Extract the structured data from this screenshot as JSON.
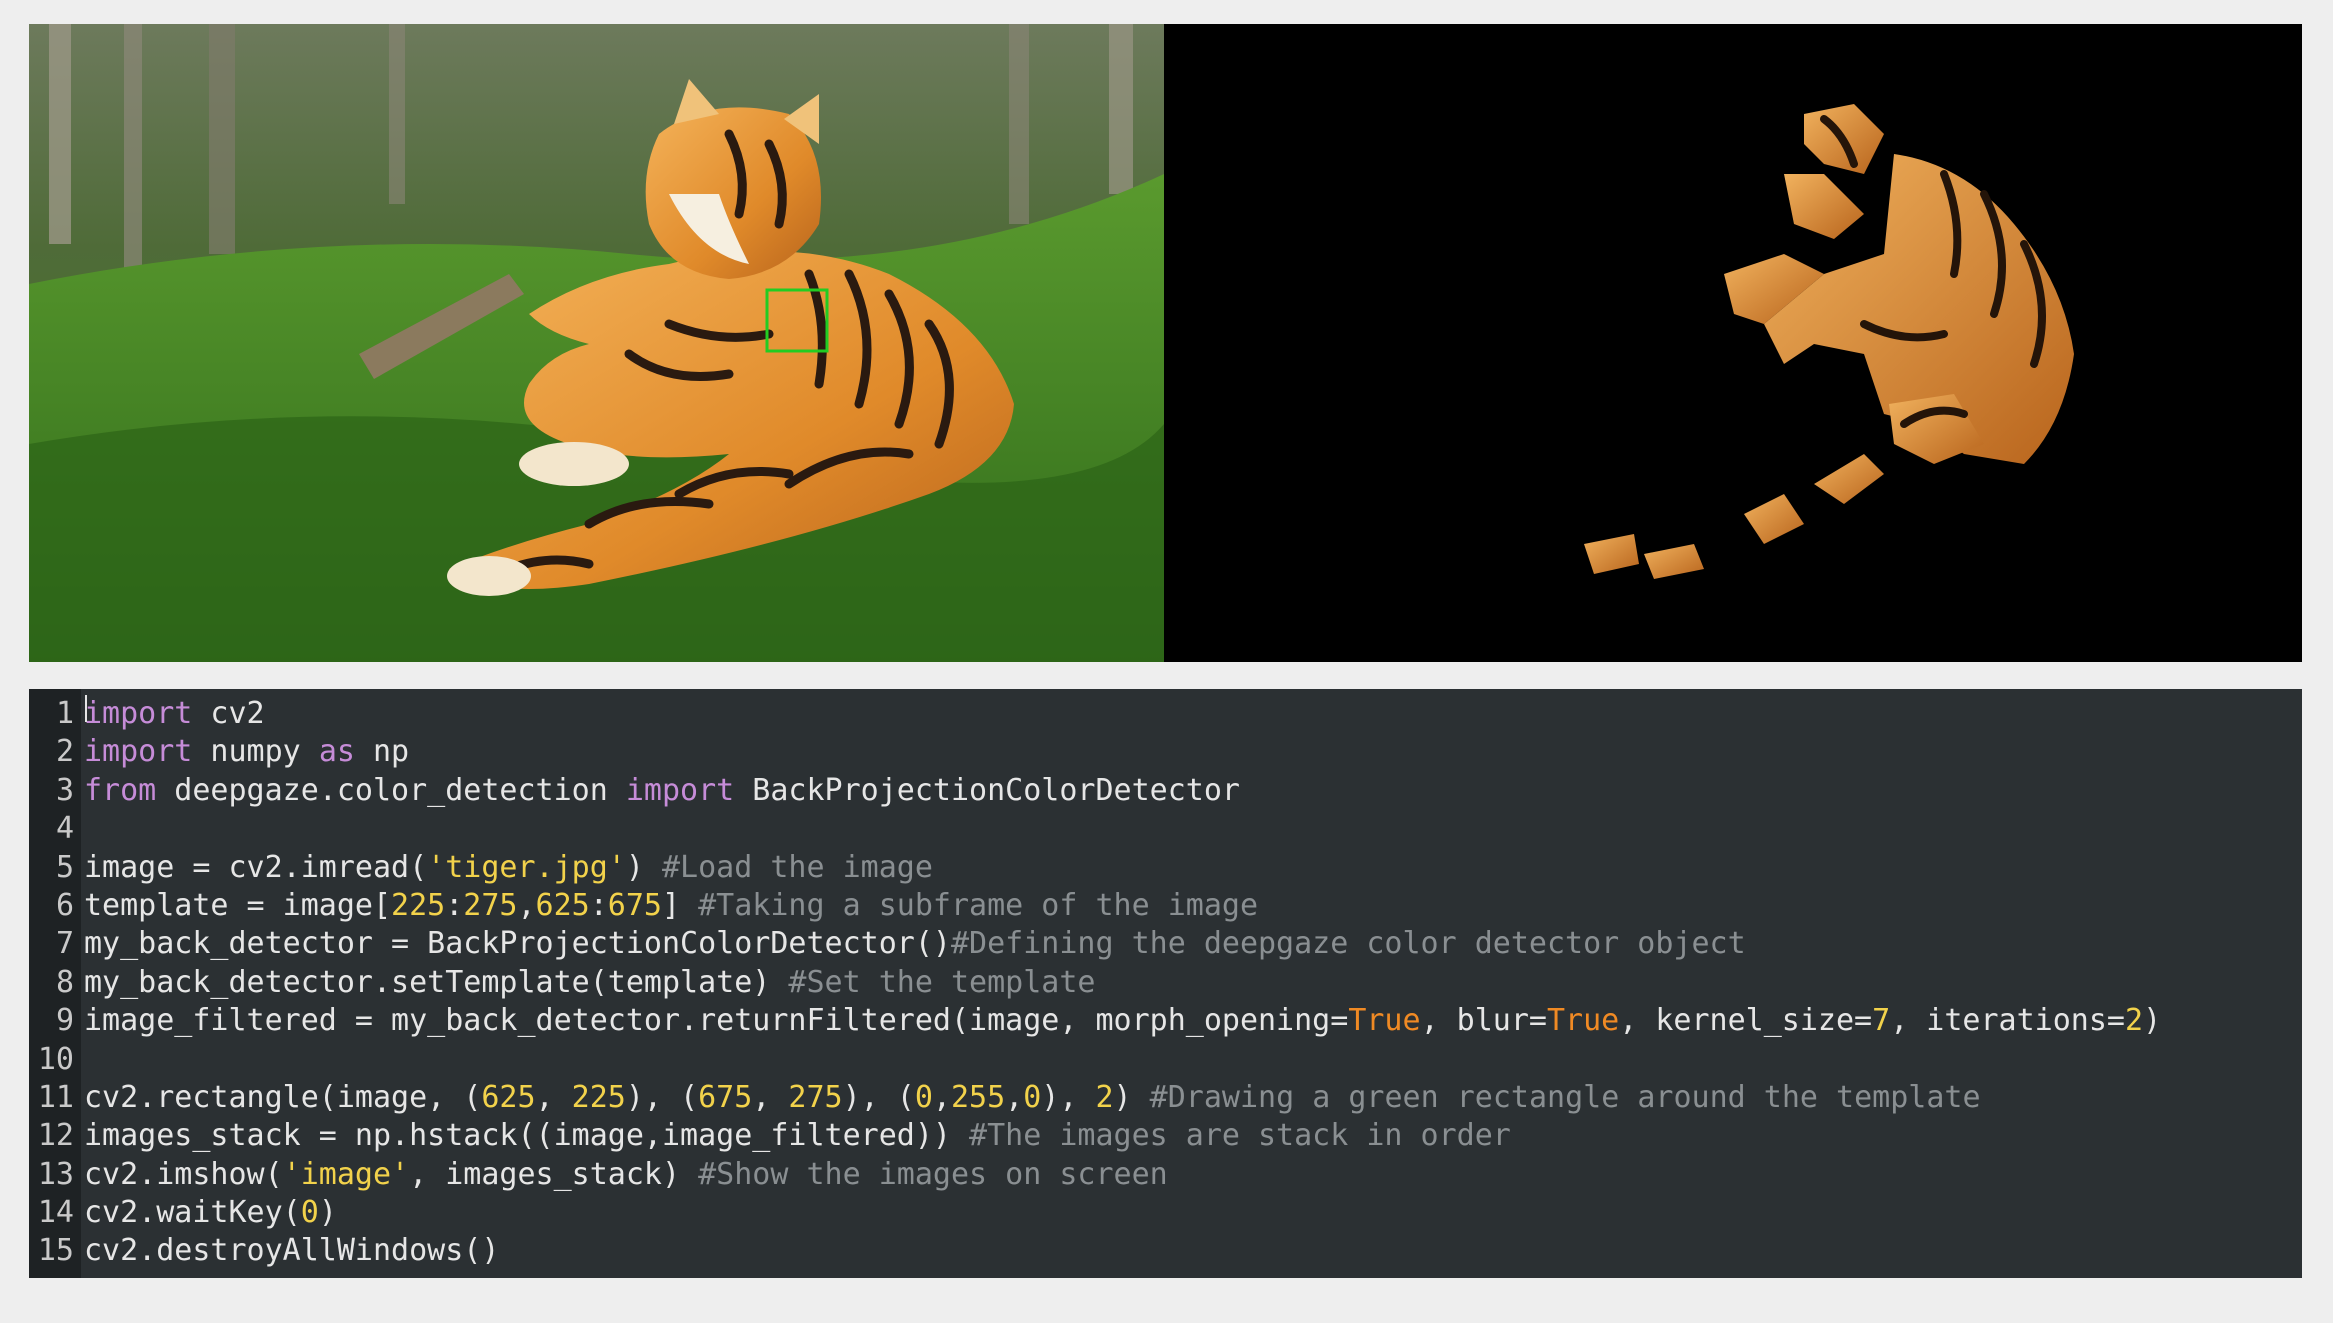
{
  "colors": {
    "page_background": "#eeeeee",
    "editor_background": "#2b3033",
    "gutter_background": "#1e2224",
    "keyword": "#c68cd8",
    "string_number": "#f2d24b",
    "boolean": "#f08a24",
    "comment": "#8a8f92",
    "text": "#e6e6e6",
    "template_rectangle": "#22cc22"
  },
  "left_image": {
    "description_icon": "tiger-photo"
  },
  "right_image": {
    "description_icon": "filtered-tiger-mask"
  },
  "editor": {
    "lines": [
      {
        "n": "1",
        "tokens": [
          [
            "kw",
            "import"
          ],
          [
            "t",
            " cv2"
          ]
        ]
      },
      {
        "n": "2",
        "tokens": [
          [
            "kw",
            "import"
          ],
          [
            "t",
            " numpy "
          ],
          [
            "kw",
            "as"
          ],
          [
            "t",
            " np"
          ]
        ]
      },
      {
        "n": "3",
        "tokens": [
          [
            "kw",
            "from"
          ],
          [
            "t",
            " deepgaze.color_detection "
          ],
          [
            "kw",
            "import"
          ],
          [
            "t",
            " BackProjectionColorDetector"
          ]
        ]
      },
      {
        "n": "4",
        "tokens": []
      },
      {
        "n": "5",
        "tokens": [
          [
            "t",
            "image = cv2.imread("
          ],
          [
            "str",
            "'tiger.jpg'"
          ],
          [
            "t",
            ") "
          ],
          [
            "cmt",
            "#Load the image"
          ]
        ]
      },
      {
        "n": "6",
        "tokens": [
          [
            "t",
            "template = image["
          ],
          [
            "num",
            "225"
          ],
          [
            "t",
            ":"
          ],
          [
            "num",
            "275"
          ],
          [
            "t",
            ","
          ],
          [
            "num",
            "625"
          ],
          [
            "t",
            ":"
          ],
          [
            "num",
            "675"
          ],
          [
            "t",
            "] "
          ],
          [
            "cmt",
            "#Taking a subframe of the image"
          ]
        ]
      },
      {
        "n": "7",
        "tokens": [
          [
            "t",
            "my_back_detector = BackProjectionColorDetector()"
          ],
          [
            "cmt",
            "#Defining the deepgaze color detector object"
          ]
        ]
      },
      {
        "n": "8",
        "tokens": [
          [
            "t",
            "my_back_detector.setTemplate(template) "
          ],
          [
            "cmt",
            "#Set the template"
          ]
        ]
      },
      {
        "n": "9",
        "tokens": [
          [
            "t",
            "image_filtered = my_back_detector.returnFiltered(image, morph_opening="
          ],
          [
            "bool",
            "True"
          ],
          [
            "t",
            ", blur="
          ],
          [
            "bool",
            "True"
          ],
          [
            "t",
            ", kernel_size="
          ],
          [
            "num",
            "7"
          ],
          [
            "t",
            ", iterations="
          ],
          [
            "num",
            "2"
          ],
          [
            "t",
            ")"
          ]
        ]
      },
      {
        "n": "10",
        "tokens": []
      },
      {
        "n": "11",
        "tokens": [
          [
            "t",
            "cv2.rectangle(image, ("
          ],
          [
            "num",
            "625"
          ],
          [
            "t",
            ", "
          ],
          [
            "num",
            "225"
          ],
          [
            "t",
            "), ("
          ],
          [
            "num",
            "675"
          ],
          [
            "t",
            ", "
          ],
          [
            "num",
            "275"
          ],
          [
            "t",
            "), ("
          ],
          [
            "num",
            "0"
          ],
          [
            "t",
            ","
          ],
          [
            "num",
            "255"
          ],
          [
            "t",
            ","
          ],
          [
            "num",
            "0"
          ],
          [
            "t",
            "), "
          ],
          [
            "num",
            "2"
          ],
          [
            "t",
            ") "
          ],
          [
            "cmt",
            "#Drawing a green rectangle around the template"
          ]
        ]
      },
      {
        "n": "12",
        "tokens": [
          [
            "t",
            "images_stack = np.hstack((image,image_filtered)) "
          ],
          [
            "cmt",
            "#The images are stack in order"
          ]
        ]
      },
      {
        "n": "13",
        "tokens": [
          [
            "t",
            "cv2.imshow("
          ],
          [
            "str",
            "'image'"
          ],
          [
            "t",
            ", images_stack) "
          ],
          [
            "cmt",
            "#Show the images on screen"
          ]
        ]
      },
      {
        "n": "14",
        "tokens": [
          [
            "t",
            "cv2.waitKey("
          ],
          [
            "num",
            "0"
          ],
          [
            "t",
            ")"
          ]
        ]
      },
      {
        "n": "15",
        "tokens": [
          [
            "t",
            "cv2.destroyAllWindows()"
          ]
        ]
      }
    ]
  }
}
